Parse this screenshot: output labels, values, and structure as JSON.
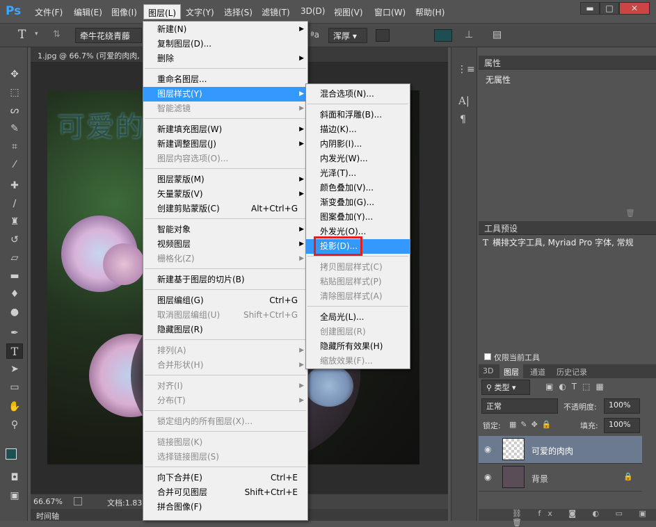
{
  "app": {
    "logo": "Ps"
  },
  "menubar": [
    "文件(F)",
    "编辑(E)",
    "图像(I)",
    "图层(L)",
    "文字(Y)",
    "选择(S)",
    "滤镜(T)",
    "3D(D)",
    "视图(V)",
    "窗口(W)",
    "帮助(H)"
  ],
  "window_controls": {
    "minimize": "▬",
    "restore": "□",
    "close": "✕"
  },
  "options": {
    "tool_glyph": "T",
    "font_family": "牵牛花绕青藤",
    "aa_label": "ªa",
    "aa_mode": "浑厚"
  },
  "document": {
    "tab_title": "1.jpg @ 66.7% (可爱的肉肉,",
    "zoom": "66.67%",
    "doc_info": "文档:1.83",
    "timeline": "时间轴",
    "watermark_text": "可爱的"
  },
  "layer_menu": [
    {
      "label": "新建(N)",
      "shortcut": "",
      "arrow": true,
      "disabled": false
    },
    {
      "label": "复制图层(D)...",
      "shortcut": "",
      "arrow": false,
      "disabled": false
    },
    {
      "label": "删除",
      "shortcut": "",
      "arrow": true,
      "disabled": false
    },
    {
      "sep": true
    },
    {
      "label": "重命名图层...",
      "shortcut": "",
      "arrow": false,
      "disabled": false
    },
    {
      "label": "图层样式(Y)",
      "shortcut": "",
      "arrow": true,
      "disabled": false,
      "highlight": true
    },
    {
      "label": "智能滤镜",
      "shortcut": "",
      "arrow": true,
      "disabled": true
    },
    {
      "sep": true
    },
    {
      "label": "新建填充图层(W)",
      "shortcut": "",
      "arrow": true,
      "disabled": false
    },
    {
      "label": "新建调整图层(J)",
      "shortcut": "",
      "arrow": true,
      "disabled": false
    },
    {
      "label": "图层内容选项(O)...",
      "shortcut": "",
      "arrow": false,
      "disabled": true
    },
    {
      "sep": true
    },
    {
      "label": "图层蒙版(M)",
      "shortcut": "",
      "arrow": true,
      "disabled": false
    },
    {
      "label": "矢量蒙版(V)",
      "shortcut": "",
      "arrow": true,
      "disabled": false
    },
    {
      "label": "创建剪贴蒙版(C)",
      "shortcut": "Alt+Ctrl+G",
      "arrow": false,
      "disabled": false
    },
    {
      "sep": true
    },
    {
      "label": "智能对象",
      "shortcut": "",
      "arrow": true,
      "disabled": false
    },
    {
      "label": "视频图层",
      "shortcut": "",
      "arrow": true,
      "disabled": false
    },
    {
      "label": "栅格化(Z)",
      "shortcut": "",
      "arrow": true,
      "disabled": true
    },
    {
      "sep": true
    },
    {
      "label": "新建基于图层的切片(B)",
      "shortcut": "",
      "arrow": false,
      "disabled": false
    },
    {
      "sep": true
    },
    {
      "label": "图层编组(G)",
      "shortcut": "Ctrl+G",
      "arrow": false,
      "disabled": false
    },
    {
      "label": "取消图层编组(U)",
      "shortcut": "Shift+Ctrl+G",
      "arrow": false,
      "disabled": true
    },
    {
      "label": "隐藏图层(R)",
      "shortcut": "",
      "arrow": false,
      "disabled": false
    },
    {
      "sep": true
    },
    {
      "label": "排列(A)",
      "shortcut": "",
      "arrow": true,
      "disabled": true
    },
    {
      "label": "合并形状(H)",
      "shortcut": "",
      "arrow": true,
      "disabled": true
    },
    {
      "sep": true
    },
    {
      "label": "对齐(I)",
      "shortcut": "",
      "arrow": true,
      "disabled": true
    },
    {
      "label": "分布(T)",
      "shortcut": "",
      "arrow": true,
      "disabled": true
    },
    {
      "sep": true
    },
    {
      "label": "锁定组内的所有图层(X)...",
      "shortcut": "",
      "arrow": false,
      "disabled": true
    },
    {
      "sep": true
    },
    {
      "label": "链接图层(K)",
      "shortcut": "",
      "arrow": false,
      "disabled": true
    },
    {
      "label": "选择链接图层(S)",
      "shortcut": "",
      "arrow": false,
      "disabled": true
    },
    {
      "sep": true
    },
    {
      "label": "向下合并(E)",
      "shortcut": "Ctrl+E",
      "arrow": false,
      "disabled": false
    },
    {
      "label": "合并可见图层",
      "shortcut": "Shift+Ctrl+E",
      "arrow": false,
      "disabled": false
    },
    {
      "label": "拼合图像(F)",
      "shortcut": "",
      "arrow": false,
      "disabled": false
    }
  ],
  "style_menu": [
    {
      "label": "混合选项(N)...",
      "disabled": false
    },
    {
      "sep": true
    },
    {
      "label": "斜面和浮雕(B)...",
      "disabled": false
    },
    {
      "label": "描边(K)...",
      "disabled": false
    },
    {
      "label": "内阴影(I)...",
      "disabled": false
    },
    {
      "label": "内发光(W)...",
      "disabled": false
    },
    {
      "label": "光泽(T)...",
      "disabled": false
    },
    {
      "label": "颜色叠加(V)...",
      "disabled": false
    },
    {
      "label": "渐变叠加(G)...",
      "disabled": false
    },
    {
      "label": "图案叠加(Y)...",
      "disabled": false
    },
    {
      "label": "外发光(O)...",
      "disabled": false
    },
    {
      "label": "投影(D)...",
      "disabled": false,
      "highlight": true
    },
    {
      "sep": true
    },
    {
      "label": "拷贝图层样式(C)",
      "disabled": true
    },
    {
      "label": "粘贴图层样式(P)",
      "disabled": true
    },
    {
      "label": "清除图层样式(A)",
      "disabled": true
    },
    {
      "sep": true
    },
    {
      "label": "全局光(L)...",
      "disabled": false
    },
    {
      "label": "创建图层(R)",
      "disabled": true
    },
    {
      "label": "隐藏所有效果(H)",
      "disabled": false
    },
    {
      "label": "缩放效果(F)...",
      "disabled": true
    }
  ],
  "properties": {
    "title": "属性",
    "content": "无属性"
  },
  "tool_presets": {
    "title": "工具预设",
    "item": "横排文字工具, Myriad Pro 字体, 常规",
    "only_current": "仅限当前工具"
  },
  "layers_panel": {
    "tabs": [
      "3D",
      "图层",
      "通道",
      "历史记录"
    ],
    "filter": "类型",
    "blend_mode": "正常",
    "opacity_label": "不透明度:",
    "opacity": "100%",
    "lock_label": "锁定:",
    "fill_label": "填充:",
    "fill": "100%",
    "layers": [
      {
        "name": "可爱的肉肉",
        "selected": true
      },
      {
        "name": "背景",
        "selected": false
      }
    ]
  },
  "colors": {
    "highlight": "#3399ff",
    "red_box": "#e02020",
    "foreground": "#1d4f52"
  }
}
